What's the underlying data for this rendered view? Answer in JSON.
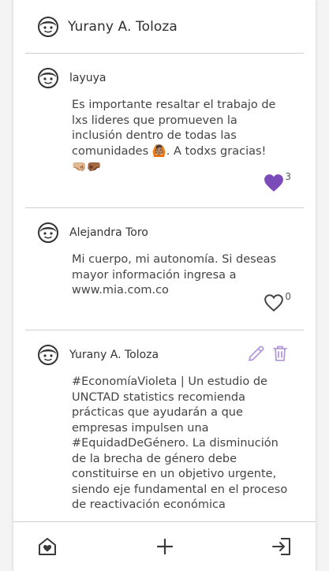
{
  "header": {
    "user_name": "Yurany A. Toloza"
  },
  "posts": [
    {
      "author": "layuya",
      "text": "Es importante resaltar el trabajo de lxs lideres que promueven la inclusión dentro de todas las comunidades 🙆🏽. A todxs gracias!",
      "emoji_line": "🤜🏼🤛🏾",
      "likes": "3",
      "liked": true
    },
    {
      "author": "Alejandra Toro",
      "text": "Mi cuerpo, mi autonomía. Si deseas mayor información ingresa a www.mia.com.co",
      "likes": "0",
      "liked": false
    },
    {
      "author": "Yurany A. Toloza",
      "text": "#EconomíaVioleta | Un estudio de UNCTAD statistics recomienda prácticas que ayudarán a que empresas impulsen una #EquidadDeGénero. La disminución de la brecha de género debe constituirse en un objetivo urgente, siendo eje fundamental en el proceso de reactivación económica"
    }
  ],
  "colors": {
    "accent": "#7b4bb8",
    "accent_light": "#b39ad8",
    "icon": "#3a3a3a"
  },
  "nav": {
    "icons": [
      "home-heart-icon",
      "plus-icon",
      "logout-icon"
    ]
  }
}
